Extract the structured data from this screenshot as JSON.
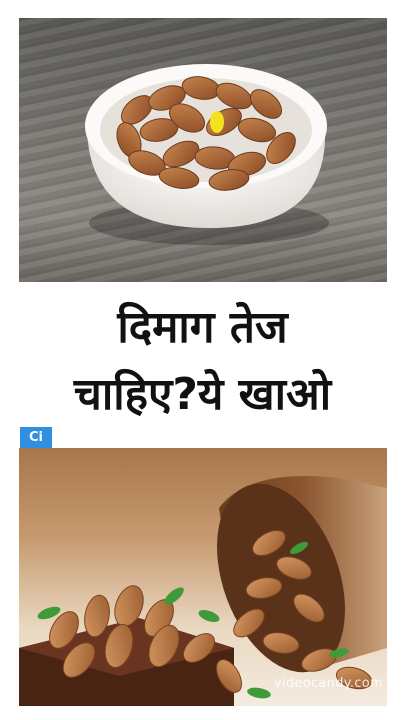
{
  "headline": {
    "line1": "दिमाग तेज",
    "line2": "चाहिए?ये खाओ"
  },
  "badge": {
    "label": "Ci"
  },
  "watermark": {
    "text": "videocandy.com"
  },
  "colors": {
    "headline_text": "#111111",
    "badge_bg": "#2f8fe0",
    "almond": "#a9643a",
    "bowl": "#f7f5f2"
  }
}
